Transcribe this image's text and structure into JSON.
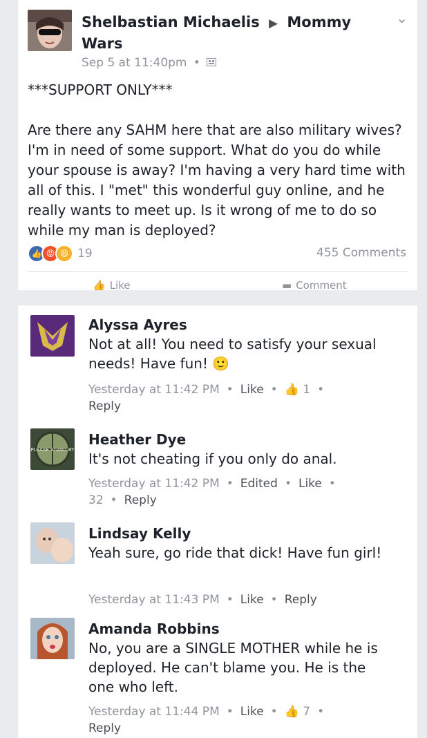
{
  "post": {
    "author": "Shelbastian Michaelis",
    "group": "Mommy Wars",
    "time": "Sep 5 at 11:40pm",
    "separator": "•",
    "body": "***SUPPORT ONLY***\n\nAre there any SAHM here that are also military wives? I'm in need of some support. What do you do while your spouse is away? I'm having a very hard time with all of this. I \"met\" this wonderful guy online, and he really wants to meet up. Is it wrong of me to do so while my man is deployed?",
    "reaction_count": "19",
    "comment_count": "455 Comments",
    "like_label": "Like",
    "comment_label": "Comment"
  },
  "comments": [
    {
      "name": "Alyssa Ayres",
      "text": "Not at all! You need to satisfy your sexual needs! Have fun! 🙂",
      "time": "Yesterday at 11:42 PM",
      "like": "Like",
      "likes": "1",
      "reply": "Reply"
    },
    {
      "name": "Heather Dye",
      "text": "It's not cheating if you only do anal.",
      "time": "Yesterday at 11:42 PM",
      "edited": "Edited",
      "like": "Like",
      "likes": "32",
      "reply": "Reply"
    },
    {
      "name": "Lindsay Kelly",
      "text": "Yeah sure, go ride that dick! Have fun girl!",
      "time": "Yesterday at 11:43 PM",
      "like": "Like",
      "reply": "Reply"
    },
    {
      "name": "Amanda Robbins",
      "text": "No, you are a SINGLE MOTHER while he is deployed. He can't blame you. He is the one who left.",
      "time": "Yesterday at 11:44 PM",
      "like": "Like",
      "likes": "7",
      "reply": "Reply"
    }
  ],
  "avatar_texts": {
    "heather": "PLEASE STAND BY"
  },
  "colors": {
    "link_blue": "#4267b2",
    "angry": "#f0502a",
    "haha": "#f7b125"
  }
}
